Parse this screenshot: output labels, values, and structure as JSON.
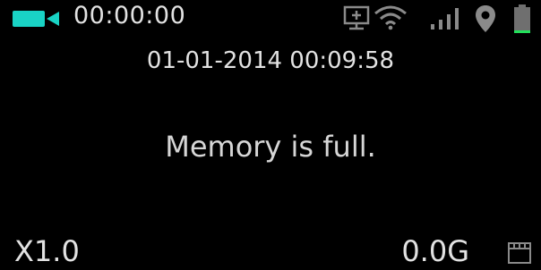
{
  "status_bar": {
    "record_time": "00:00:00",
    "icons": [
      "video-camera-icon",
      "screen-icon",
      "wifi-icon",
      "signal-icon",
      "location-icon",
      "battery-icon"
    ],
    "camera_color": "#19d3c5",
    "battery_color": "#22e05a"
  },
  "datetime": "01-01-2014 00:09:58",
  "message": "Memory is full.",
  "footer": {
    "zoom": "X1.0",
    "storage": "0.0G",
    "icon": "sd-card-icon"
  }
}
